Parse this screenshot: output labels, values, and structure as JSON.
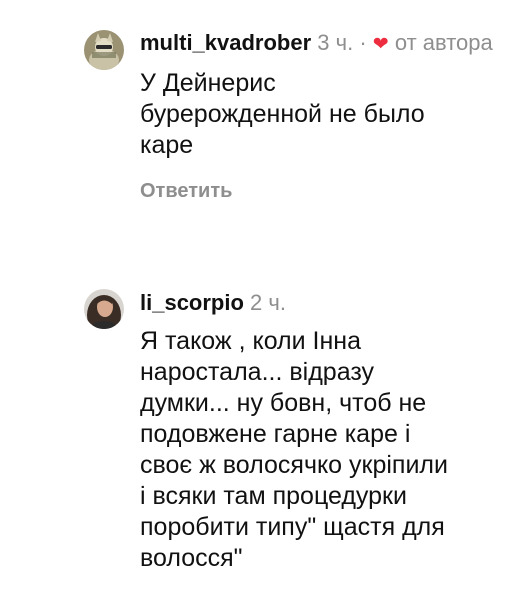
{
  "comments": [
    {
      "username": "multi_kvadrober",
      "time": "3 ч.",
      "separator": "·",
      "heart_icon": "heart-icon",
      "heart_color": "#ed2d3f",
      "liked_by_author": "от автора",
      "text": "У Дейнерис\nбурерожденной не было\nкаре",
      "reply_label": "Ответить"
    },
    {
      "username": "li_scorpio",
      "time": "2 ч.",
      "text": "Я також , коли Інна\nнаростала... відразу\nдумки... ну бовн, чтоб не\nподовжене гарне каре і\nсвоє ж волосячко укріпили\nі всяки там процедурки\nпоробити типу\" щастя для\nволосся\""
    }
  ]
}
